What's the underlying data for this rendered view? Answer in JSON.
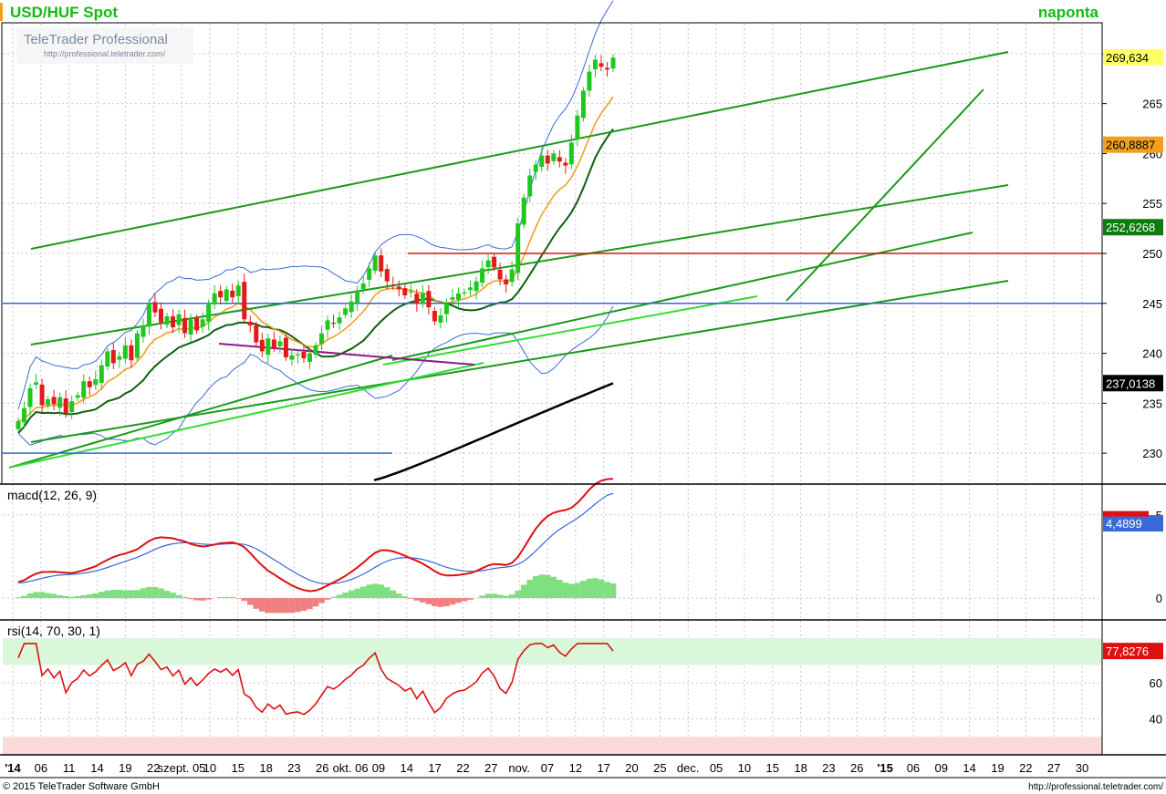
{
  "header": {
    "title": "USD/HUF Spot",
    "period": "naponta",
    "brand_name": "TeleTrader Professional",
    "brand_url": "http://professional.teletrader.com/"
  },
  "footer": {
    "copyright": "© 2015 TeleTrader Software GmbH",
    "url": "http://professional.teletrader.com/"
  },
  "colors": {
    "up_candle": "#1fc81f",
    "down_candle": "#e21a1a",
    "trendline": "#1a9a1a",
    "light_trend": "#33dd33",
    "resistance": "#dd1111",
    "support": "#3366dd",
    "ema_fast": "#f0a020",
    "sma_mid": "#106010",
    "sma_long": "#000000",
    "bollinger": "#3a6ad8",
    "macd_line": "#dd1111",
    "signal_line": "#3366dd",
    "hist_pos": "#7fe07f",
    "hist_neg": "#f08080",
    "rsi_line": "#dd1111",
    "rsi_overbought": "#d9f7d9",
    "rsi_oversold": "#fbdada"
  },
  "chart_data": [
    {
      "type": "candlestick",
      "title": "USD/HUF Spot",
      "ylim": [
        227,
        273
      ],
      "y_ticks": [
        230,
        235,
        240,
        245,
        250,
        255,
        260,
        265,
        270
      ],
      "x_tick_labels": [
        "'14",
        "06",
        "11",
        "14",
        "19",
        "22",
        "szept. 05",
        "10",
        "15",
        "18",
        "23",
        "26",
        "okt. 06",
        "09",
        "14",
        "17",
        "22",
        "27",
        "nov.",
        "07",
        "12",
        "17",
        "20",
        "25",
        "dec.",
        "05",
        "10",
        "15",
        "18",
        "23",
        "26",
        "'15",
        "06",
        "09",
        "14",
        "19",
        "22",
        "27",
        "30"
      ],
      "price_labels": [
        {
          "text": "269,634",
          "value": 269.634
        },
        {
          "text": "260,8887",
          "value": 260.8887
        },
        {
          "text": "252,6268",
          "value": 252.6268
        },
        {
          "text": "237,0138",
          "value": 237.0138
        }
      ],
      "horizontal_levels": [
        {
          "name": "resistance",
          "value": 250.0
        },
        {
          "name": "support",
          "value": 245.0
        },
        {
          "name": "support-low",
          "value": 230.0
        }
      ],
      "closes": [
        233.2,
        234.5,
        236.5,
        237.1,
        234.8,
        235.4,
        234.9,
        235.6,
        234.0,
        235.2,
        235.8,
        237.2,
        236.6,
        237.4,
        238.8,
        240.2,
        239.0,
        239.7,
        240.8,
        239.3,
        242.0,
        242.8,
        245.0,
        244.1,
        243.1,
        243.7,
        242.6,
        243.9,
        242.0,
        243.4,
        242.3,
        243.4,
        244.9,
        246.0,
        245.6,
        246.4,
        245.6,
        246.8,
        243.4,
        242.8,
        241.1,
        240.2,
        241.5,
        240.6,
        241.2,
        239.6,
        239.8,
        239.9,
        239.5,
        240.0,
        240.8,
        242.0,
        243.3,
        243.0,
        243.6,
        244.5,
        245.2,
        246.3,
        247.0,
        248.5,
        249.8,
        248.2,
        247.2,
        246.8,
        246.4,
        245.8,
        246.2,
        245.0,
        246.0,
        244.6,
        243.2,
        243.8,
        245.0,
        245.6,
        246.0,
        246.1,
        246.6,
        247.2,
        248.5,
        249.3,
        248.6,
        247.4,
        246.9,
        248.4,
        253.0,
        255.6,
        257.8,
        258.9,
        259.8,
        259.0,
        260.0,
        259.2,
        258.8,
        261.1,
        263.8,
        266.3,
        268.2,
        269.4,
        268.7,
        268.4,
        269.6
      ],
      "ema_fast": {
        "start": 229.4,
        "end": 260.9
      },
      "sma_mid": {
        "start": 227.5,
        "end": 252.6
      },
      "sma_long": {
        "start": 227.3,
        "end": 237.0
      },
      "bollinger_upper_last": 273.0,
      "bollinger_lower_last": 250.6
    },
    {
      "type": "line",
      "title": "macd(12, 26, 9)",
      "ylim": [
        -1.2,
        5.7
      ],
      "y_ticks": [
        0,
        5
      ],
      "series": [
        {
          "name": "macd",
          "last": 4.9
        },
        {
          "name": "signal",
          "last": 4.4899
        }
      ],
      "value_labels": [
        "4,4899"
      ]
    },
    {
      "type": "line",
      "title": "rsi(14, 70, 30, 1)",
      "ylim": [
        20,
        85
      ],
      "y_ticks": [
        40,
        60
      ],
      "levels": [
        70,
        30
      ],
      "last": 77.8276,
      "value_labels": [
        "77,8276"
      ]
    }
  ]
}
